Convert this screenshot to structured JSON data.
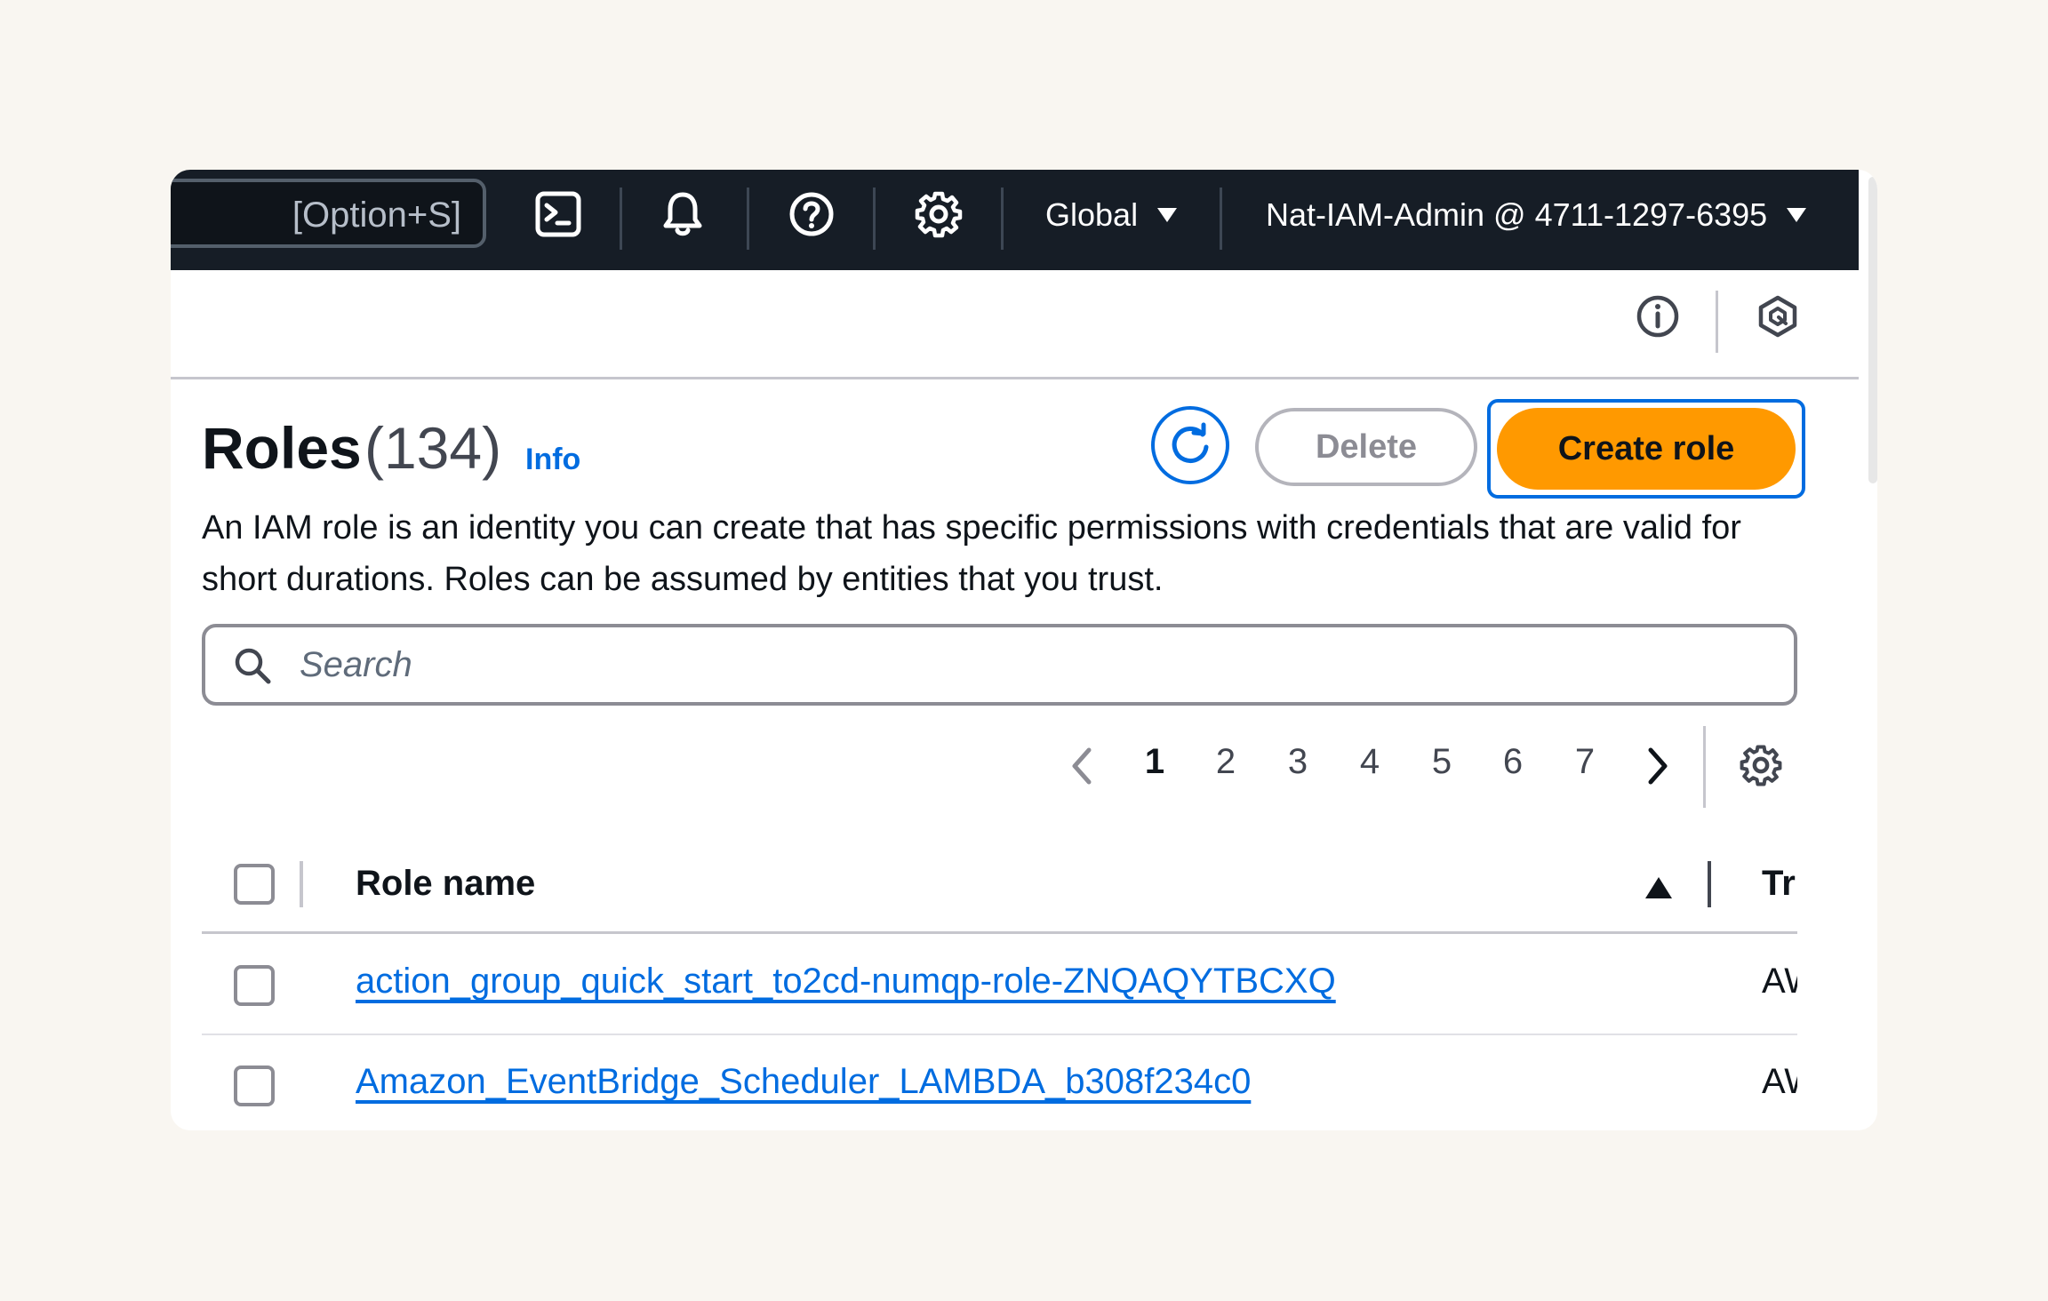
{
  "top_nav": {
    "search_shortcut": "[Option+S]",
    "region": "Global",
    "account": "Nat-IAM-Admin @ 4711-1297-6395",
    "icons": [
      "cloudshell-icon",
      "bell-icon",
      "help-icon",
      "gear-icon"
    ]
  },
  "utility_bar": {
    "icons": [
      "info-icon",
      "q-icon"
    ]
  },
  "header": {
    "title": "Roles",
    "count": "(134)",
    "info_link": "Info",
    "description": "An IAM role is an identity you can create that has specific permissions with credentials that are valid for short durations. Roles can be assumed by entities that you trust.",
    "delete_label": "Delete",
    "create_label": "Create role"
  },
  "search": {
    "placeholder": "Search"
  },
  "pagination": {
    "pages": [
      "1",
      "2",
      "3",
      "4",
      "5",
      "6",
      "7"
    ],
    "current": "1"
  },
  "table": {
    "columns": [
      "Role name",
      "Tr"
    ],
    "sort": "ascending",
    "rows": [
      {
        "role_name": "action_group_quick_start_to2cd-numqp-role-ZNQAQYTBCXQ",
        "trusted": "AW"
      },
      {
        "role_name": "Amazon_EventBridge_Scheduler_LAMBDA_b308f234c0",
        "trusted": "AW"
      }
    ]
  },
  "colors": {
    "nav_bg": "#161d26",
    "accent": "#006ce0",
    "primary_button": "#ff9900",
    "page_bg": "#f9f6f1"
  }
}
